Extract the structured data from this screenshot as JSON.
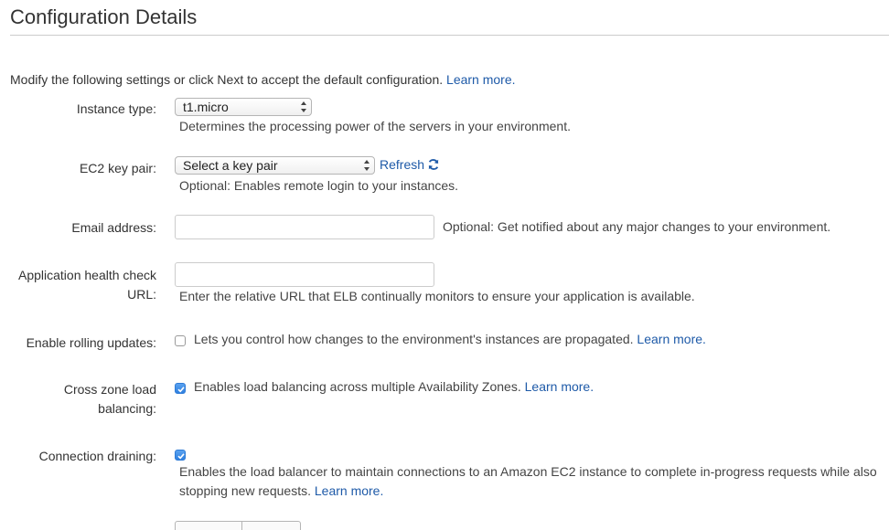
{
  "header": {
    "title": "Configuration Details"
  },
  "intro": {
    "text": "Modify the following settings or click Next to accept the default configuration.",
    "learn_more": "Learn more."
  },
  "instance_type": {
    "label": "Instance type:",
    "value": "t1.micro",
    "help": "Determines the processing power of the servers in your environment."
  },
  "key_pair": {
    "label": "EC2 key pair:",
    "value": "Select a key pair",
    "refresh": "Refresh",
    "help": "Optional: Enables remote login to your instances."
  },
  "email": {
    "label": "Email address:",
    "value": "",
    "help": "Optional: Get notified about any major changes to your environment."
  },
  "health_check": {
    "label_line1": "Application health check",
    "label_line2": "URL:",
    "value": "",
    "help": "Enter the relative URL that ELB continually monitors to ensure your application is available."
  },
  "rolling_updates": {
    "label": "Enable rolling updates:",
    "checked": false,
    "help": "Lets you control how changes to the environment's instances are propagated.",
    "learn_more": "Learn more."
  },
  "cross_zone": {
    "label_line1": "Cross zone load",
    "label_line2": "balancing:",
    "checked": true,
    "help": "Enables load balancing across multiple Availability Zones.",
    "learn_more": "Learn more."
  },
  "connection_draining": {
    "label": "Connection draining:",
    "checked": true,
    "help_line1": "Enables the load balancer to maintain connections to an Amazon EC2 instance to complete in-progress requests while also",
    "help_line2": "stopping new requests.",
    "learn_more": "Learn more."
  },
  "colors": {
    "link": "#1e5aa8",
    "checkbox_checked": "#2f80e0"
  }
}
